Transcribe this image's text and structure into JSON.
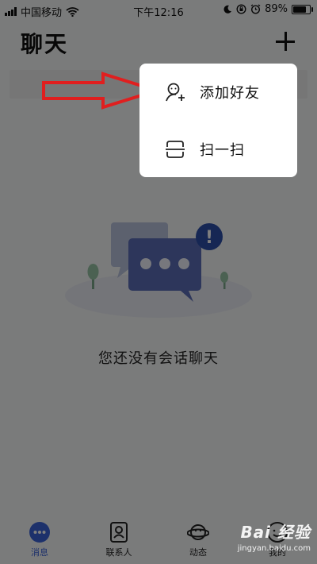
{
  "status_bar": {
    "carrier": "中国移动",
    "time": "下午12:16",
    "battery_percent": "89%",
    "battery_level": 0.89,
    "icons": [
      "signal-icon",
      "wifi-icon",
      "moon-icon",
      "rotation-lock-icon",
      "alarm-icon",
      "battery-icon"
    ]
  },
  "header": {
    "title": "聊天",
    "add_icon": "plus-icon"
  },
  "empty_state": {
    "message": "您还没有会话聊天",
    "illustration": "chat-bubbles-illustration",
    "badge_glyph": "!"
  },
  "popup_menu": {
    "items": [
      {
        "label": "添加好友",
        "icon": "add-friend-icon"
      },
      {
        "label": "扫一扫",
        "icon": "scan-icon"
      }
    ]
  },
  "tab_bar": {
    "tabs": [
      {
        "label": "消息",
        "icon": "message-icon",
        "active": true
      },
      {
        "label": "联系人",
        "icon": "contacts-icon",
        "active": false
      },
      {
        "label": "动态",
        "icon": "planet-icon",
        "active": false
      },
      {
        "label": "我的",
        "icon": "profile-icon",
        "active": false
      }
    ]
  },
  "watermark": {
    "logo": "Bai  经验",
    "url": "jingyan.baidu.com"
  },
  "colors": {
    "accent": "#3b62d6",
    "overlay": "rgba(0,0,0,0.5)",
    "arrow": "#e01f1f",
    "badge": "#2d4fa8"
  }
}
